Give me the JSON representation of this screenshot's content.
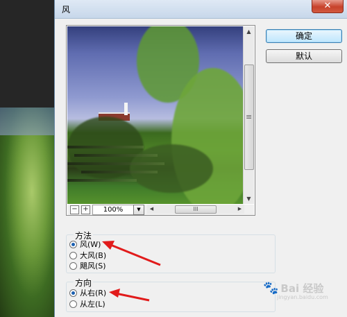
{
  "dialog": {
    "title": "风",
    "close_label": "✕"
  },
  "buttons": {
    "ok_label": "确定",
    "default_label": "默认"
  },
  "preview": {
    "zoom_value": "100%",
    "zoom_out_label": "−",
    "zoom_in_label": "+",
    "dropdown_icon": "▼",
    "hscroll_grip": "III",
    "vscroll_grip": "≡"
  },
  "method_group": {
    "title": "方法",
    "options": [
      {
        "label": "风(W)",
        "checked": true
      },
      {
        "label": "大风(B)",
        "checked": false
      },
      {
        "label": "飓风(S)",
        "checked": false
      }
    ]
  },
  "direction_group": {
    "title": "方向",
    "options": [
      {
        "label": "从右(R)",
        "checked": true
      },
      {
        "label": "从左(L)",
        "checked": false
      }
    ]
  },
  "watermark": {
    "text": "Bai 经验",
    "url": "jingyan.baidu.com"
  },
  "colors": {
    "annotation_arrow": "#e11b1b",
    "primary_button": "#bee6fd",
    "close_button": "#c7422b"
  }
}
